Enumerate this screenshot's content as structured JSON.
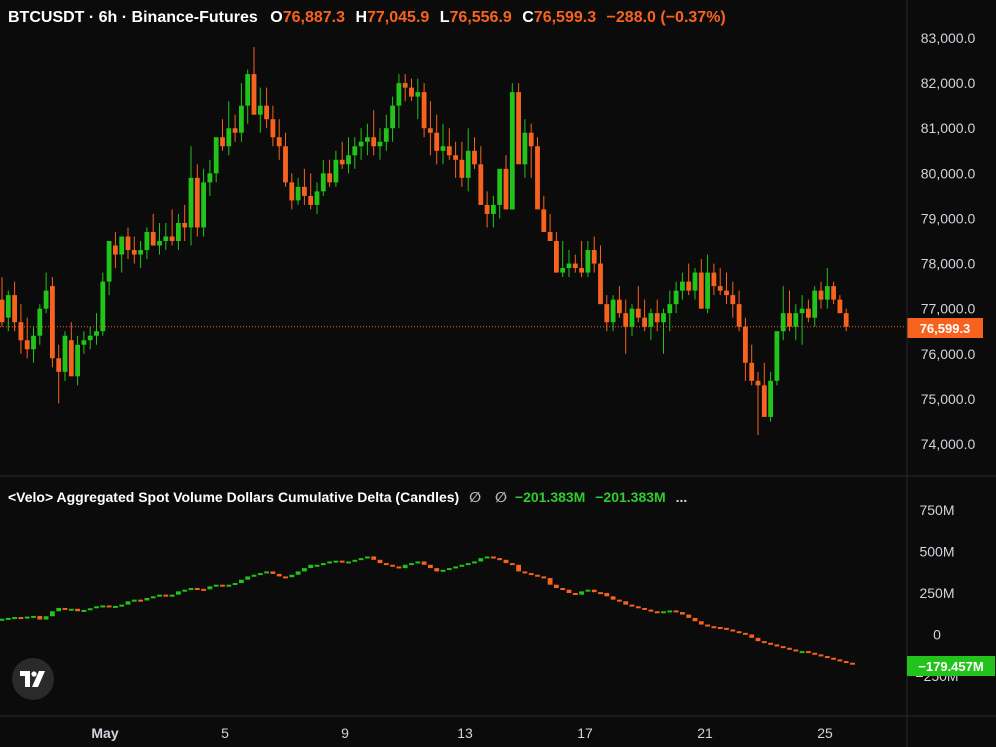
{
  "header": {
    "symbol": "BTCUSDT · 6h · Binance-Futures",
    "o_label": "O",
    "o_value": "76,887.3",
    "h_label": "H",
    "h_value": "77,045.9",
    "l_label": "L",
    "l_value": "76,556.9",
    "c_label": "C",
    "c_value": "76,599.3",
    "change": "−288.0 (−0.37%)"
  },
  "indicator": {
    "title": "<Velo> Aggregated Spot Volume Dollars Cumulative Delta (Candles)",
    "phi1": "∅",
    "phi2": "∅",
    "value1": "−201.383M",
    "value2": "−201.383M",
    "more": "..."
  },
  "colors": {
    "up": "#22c31a",
    "down": "#f7631f",
    "background": "#0b0b0b",
    "text": "#d1d4dc",
    "indicator_label_bg": "#22c31a"
  },
  "logo_icon": "tradingview-logo-icon",
  "chart_data": [
    {
      "type": "candlestick",
      "title": "BTCUSDT · 6h · Binance-Futures",
      "ylim": [
        73400,
        83400
      ],
      "y_ticks": [
        74000,
        75000,
        76000,
        77000,
        78000,
        79000,
        80000,
        81000,
        82000,
        83000
      ],
      "y_tick_labels": [
        "74,000.0",
        "75,000.0",
        "76,000.0",
        "77,000.0",
        "78,000.0",
        "79,000.0",
        "80,000.0",
        "81,000.0",
        "82,000.0",
        "83,000.0"
      ],
      "last_price": 76599.3,
      "last_price_label": "76,599.3",
      "x_tick_labels": [
        "May",
        "5",
        "9",
        "13",
        "17",
        "21",
        "25"
      ],
      "candles": [
        [
          77200,
          77700,
          76600,
          76700
        ],
        [
          76800,
          77400,
          76500,
          77300
        ],
        [
          77300,
          77600,
          76500,
          76700
        ],
        [
          76700,
          77100,
          76000,
          76300
        ],
        [
          76300,
          76800,
          75900,
          76100
        ],
        [
          76100,
          76600,
          75800,
          76400
        ],
        [
          76400,
          77100,
          76200,
          77000
        ],
        [
          77000,
          77800,
          76900,
          77400
        ],
        [
          77500,
          77700,
          75700,
          75900
        ],
        [
          75900,
          76200,
          74900,
          75600
        ],
        [
          75600,
          76500,
          75400,
          76400
        ],
        [
          76300,
          76700,
          75800,
          75500
        ],
        [
          75500,
          76400,
          75300,
          76200
        ],
        [
          76200,
          76500,
          76000,
          76300
        ],
        [
          76300,
          76600,
          76100,
          76400
        ],
        [
          76400,
          76900,
          76200,
          76500
        ],
        [
          76500,
          77800,
          76400,
          77600
        ],
        [
          77600,
          78200,
          77300,
          78500
        ],
        [
          78400,
          78700,
          77900,
          78200
        ],
        [
          78200,
          78600,
          77800,
          78600
        ],
        [
          78600,
          78800,
          78100,
          78300
        ],
        [
          78300,
          78600,
          78000,
          78200
        ],
        [
          78200,
          78500,
          77900,
          78300
        ],
        [
          78300,
          78800,
          78100,
          78700
        ],
        [
          78700,
          79100,
          78500,
          78400
        ],
        [
          78400,
          78900,
          78200,
          78500
        ],
        [
          78500,
          78900,
          78300,
          78600
        ],
        [
          78600,
          79200,
          78400,
          78500
        ],
        [
          78500,
          79100,
          78300,
          78900
        ],
        [
          78900,
          79300,
          78500,
          78800
        ],
        [
          78800,
          80600,
          78400,
          79900
        ],
        [
          79900,
          80200,
          78600,
          78800
        ],
        [
          78800,
          80100,
          78600,
          79800
        ],
        [
          79800,
          80300,
          79500,
          80000
        ],
        [
          80000,
          80500,
          79800,
          80800
        ],
        [
          80800,
          81200,
          80500,
          80600
        ],
        [
          80600,
          81600,
          80400,
          81000
        ],
        [
          81000,
          81300,
          80700,
          80900
        ],
        [
          80900,
          82000,
          80700,
          81500
        ],
        [
          81500,
          82300,
          81100,
          82200
        ],
        [
          82200,
          82800,
          81300,
          81300
        ],
        [
          81300,
          81900,
          80900,
          81500
        ],
        [
          81500,
          81900,
          81000,
          81200
        ],
        [
          81200,
          81500,
          80600,
          80800
        ],
        [
          80800,
          81200,
          80300,
          80600
        ],
        [
          80600,
          80900,
          79700,
          79800
        ],
        [
          79800,
          80000,
          79200,
          79400
        ],
        [
          79400,
          79900,
          79300,
          79700
        ],
        [
          79700,
          80100,
          79300,
          79500
        ],
        [
          79500,
          80000,
          79200,
          79300
        ],
        [
          79300,
          79800,
          79100,
          79600
        ],
        [
          79600,
          80300,
          79500,
          80000
        ],
        [
          80000,
          80300,
          79700,
          79800
        ],
        [
          79800,
          80500,
          79700,
          80300
        ],
        [
          80300,
          80700,
          80100,
          80200
        ],
        [
          80200,
          80800,
          80000,
          80400
        ],
        [
          80400,
          80800,
          80100,
          80600
        ],
        [
          80600,
          81000,
          80300,
          80700
        ],
        [
          80700,
          81100,
          80400,
          80800
        ],
        [
          80800,
          81400,
          80400,
          80600
        ],
        [
          80600,
          81000,
          80300,
          80700
        ],
        [
          80700,
          81300,
          80500,
          81000
        ],
        [
          81000,
          81700,
          80700,
          81500
        ],
        [
          81500,
          82200,
          81000,
          82000
        ],
        [
          82000,
          82200,
          81600,
          81900
        ],
        [
          81900,
          82100,
          81600,
          81700
        ],
        [
          81700,
          82100,
          81200,
          81800
        ],
        [
          81800,
          82000,
          80800,
          81000
        ],
        [
          81000,
          81600,
          80400,
          80900
        ],
        [
          80900,
          81300,
          80200,
          80500
        ],
        [
          80500,
          81100,
          80200,
          80600
        ],
        [
          80600,
          81000,
          80300,
          80400
        ],
        [
          80400,
          80700,
          79900,
          80300
        ],
        [
          80300,
          80700,
          79700,
          79900
        ],
        [
          79900,
          81000,
          79600,
          80500
        ],
        [
          80500,
          80800,
          80100,
          80200
        ],
        [
          80200,
          80600,
          79700,
          79300
        ],
        [
          79300,
          79600,
          78800,
          79100
        ],
        [
          79100,
          79500,
          78800,
          79300
        ],
        [
          79300,
          79900,
          79000,
          80100
        ],
        [
          80100,
          80400,
          79300,
          79200
        ],
        [
          79200,
          82000,
          79200,
          81800
        ],
        [
          81800,
          82000,
          80400,
          80200
        ],
        [
          80200,
          81200,
          79900,
          80900
        ],
        [
          80900,
          81100,
          79900,
          80600
        ],
        [
          80600,
          80800,
          79900,
          79200
        ],
        [
          79200,
          79500,
          78700,
          78700
        ],
        [
          78700,
          79100,
          78500,
          78500
        ],
        [
          78500,
          78700,
          77900,
          77800
        ],
        [
          77800,
          78500,
          77700,
          77900
        ],
        [
          77900,
          78300,
          77700,
          78000
        ],
        [
          78000,
          78200,
          77800,
          77900
        ],
        [
          77900,
          78500,
          77700,
          77800
        ],
        [
          77800,
          78500,
          77700,
          78300
        ],
        [
          78300,
          78600,
          77800,
          78000
        ],
        [
          78000,
          78400,
          77200,
          77100
        ],
        [
          77100,
          77300,
          76500,
          76700
        ],
        [
          76700,
          77300,
          76500,
          77200
        ],
        [
          77200,
          77500,
          76800,
          76900
        ],
        [
          76900,
          77200,
          76000,
          76600
        ],
        [
          76600,
          77100,
          76400,
          77000
        ],
        [
          77000,
          77500,
          76700,
          76800
        ],
        [
          76800,
          77200,
          76500,
          76600
        ],
        [
          76600,
          77000,
          76300,
          76900
        ],
        [
          76900,
          77200,
          76500,
          76700
        ],
        [
          76700,
          77000,
          76000,
          76900
        ],
        [
          76900,
          77400,
          76500,
          77100
        ],
        [
          77100,
          77600,
          76900,
          77400
        ],
        [
          77400,
          77800,
          77200,
          77600
        ],
        [
          77600,
          78000,
          77300,
          77400
        ],
        [
          77400,
          77900,
          77200,
          77800
        ],
        [
          77800,
          78100,
          77200,
          77000
        ],
        [
          77000,
          78200,
          76900,
          77800
        ],
        [
          77800,
          78000,
          77300,
          77500
        ],
        [
          77500,
          77900,
          77300,
          77400
        ],
        [
          77400,
          77800,
          77100,
          77300
        ],
        [
          77300,
          77600,
          76800,
          77100
        ],
        [
          77100,
          77400,
          76500,
          76600
        ],
        [
          76600,
          76800,
          75400,
          75800
        ],
        [
          75800,
          76200,
          75300,
          75400
        ],
        [
          75400,
          75600,
          74200,
          75300
        ],
        [
          75300,
          75800,
          74700,
          74600
        ],
        [
          74600,
          75600,
          74500,
          75400
        ],
        [
          75400,
          76500,
          75300,
          76500
        ],
        [
          76500,
          77500,
          76300,
          76900
        ],
        [
          76900,
          77400,
          76500,
          76600
        ],
        [
          76600,
          77100,
          76300,
          76900
        ],
        [
          76900,
          77300,
          76200,
          77000
        ],
        [
          77000,
          77200,
          76700,
          76800
        ],
        [
          76800,
          77500,
          76600,
          77400
        ],
        [
          77400,
          77600,
          77000,
          77200
        ],
        [
          77200,
          77900,
          77000,
          77500
        ],
        [
          77500,
          77600,
          77100,
          77200
        ],
        [
          77200,
          77300,
          76900,
          76900
        ],
        [
          76900,
          77000,
          76500,
          76600
        ]
      ]
    },
    {
      "type": "candlestick",
      "title": "<Velo> Aggregated Spot Volume Dollars Cumulative Delta (Candles)",
      "units": "M",
      "ylim": [
        -370,
        860
      ],
      "y_ticks": [
        -250,
        0,
        250,
        500,
        750
      ],
      "y_tick_labels": [
        "−250M",
        "0",
        "250M",
        "500M",
        "750M"
      ],
      "last_value": -179.457,
      "last_value_label": "−179.457M",
      "series_values": [
        95,
        100,
        105,
        102,
        108,
        112,
        90,
        110,
        140,
        160,
        150,
        155,
        140,
        148,
        158,
        170,
        175,
        170,
        172,
        180,
        200,
        210,
        205,
        220,
        230,
        240,
        235,
        240,
        260,
        270,
        280,
        275,
        272,
        290,
        300,
        295,
        300,
        310,
        330,
        350,
        360,
        370,
        380,
        365,
        350,
        345,
        360,
        380,
        400,
        420,
        420,
        430,
        440,
        445,
        435,
        440,
        450,
        460,
        470,
        450,
        430,
        420,
        410,
        400,
        420,
        430,
        440,
        420,
        400,
        380,
        390,
        400,
        410,
        420,
        430,
        440,
        460,
        470,
        460,
        450,
        430,
        420,
        380,
        370,
        360,
        350,
        340,
        300,
        280,
        270,
        250,
        240,
        260,
        270,
        255,
        250,
        230,
        210,
        200,
        180,
        170,
        160,
        150,
        140,
        130,
        140,
        145,
        135,
        120,
        100,
        80,
        60,
        50,
        45,
        40,
        30,
        20,
        10,
        0,
        -20,
        -40,
        -50,
        -60,
        -70,
        -80,
        -90,
        -100,
        -100,
        -110,
        -120,
        -130,
        -140,
        -150,
        -160,
        -170,
        -180
      ]
    }
  ]
}
